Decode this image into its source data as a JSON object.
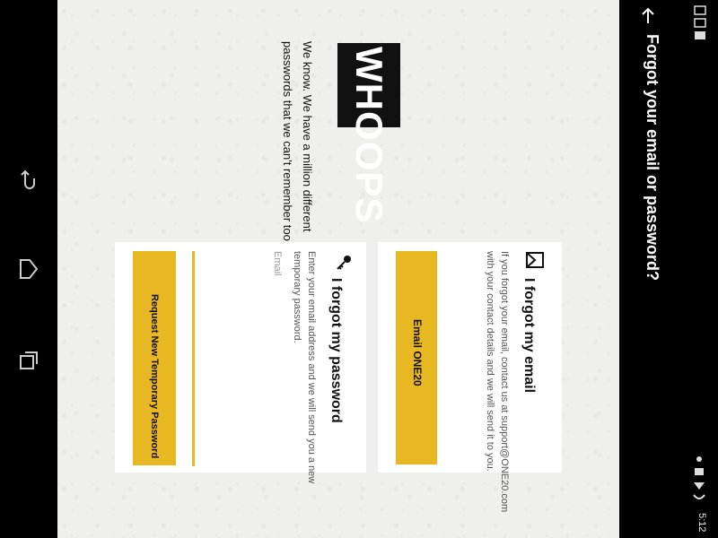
{
  "appbar": {
    "title": "Forgot your email or password?"
  },
  "statusbar": {
    "time": "5:12"
  },
  "hero": {
    "logo_text": "WHOOPS",
    "line1": "We know.  We have a million different",
    "line2": "passwords that we can't remember too."
  },
  "email_card": {
    "title": "I forgot my email",
    "body_line1": "If you forgot your email, contact us at support@ONE20.com",
    "body_line2": "with your contact details and we will send it to you.",
    "button_label": "Email ONE20"
  },
  "password_card": {
    "title": "I forgot my password",
    "body_line1": "Enter your email address and we will send you a new",
    "body_line2": "temporary password.",
    "email_placeholder": "Email",
    "button_label": "Request New Temporary Password"
  },
  "colors": {
    "accent": "#e8b823",
    "bar": "#000000"
  }
}
